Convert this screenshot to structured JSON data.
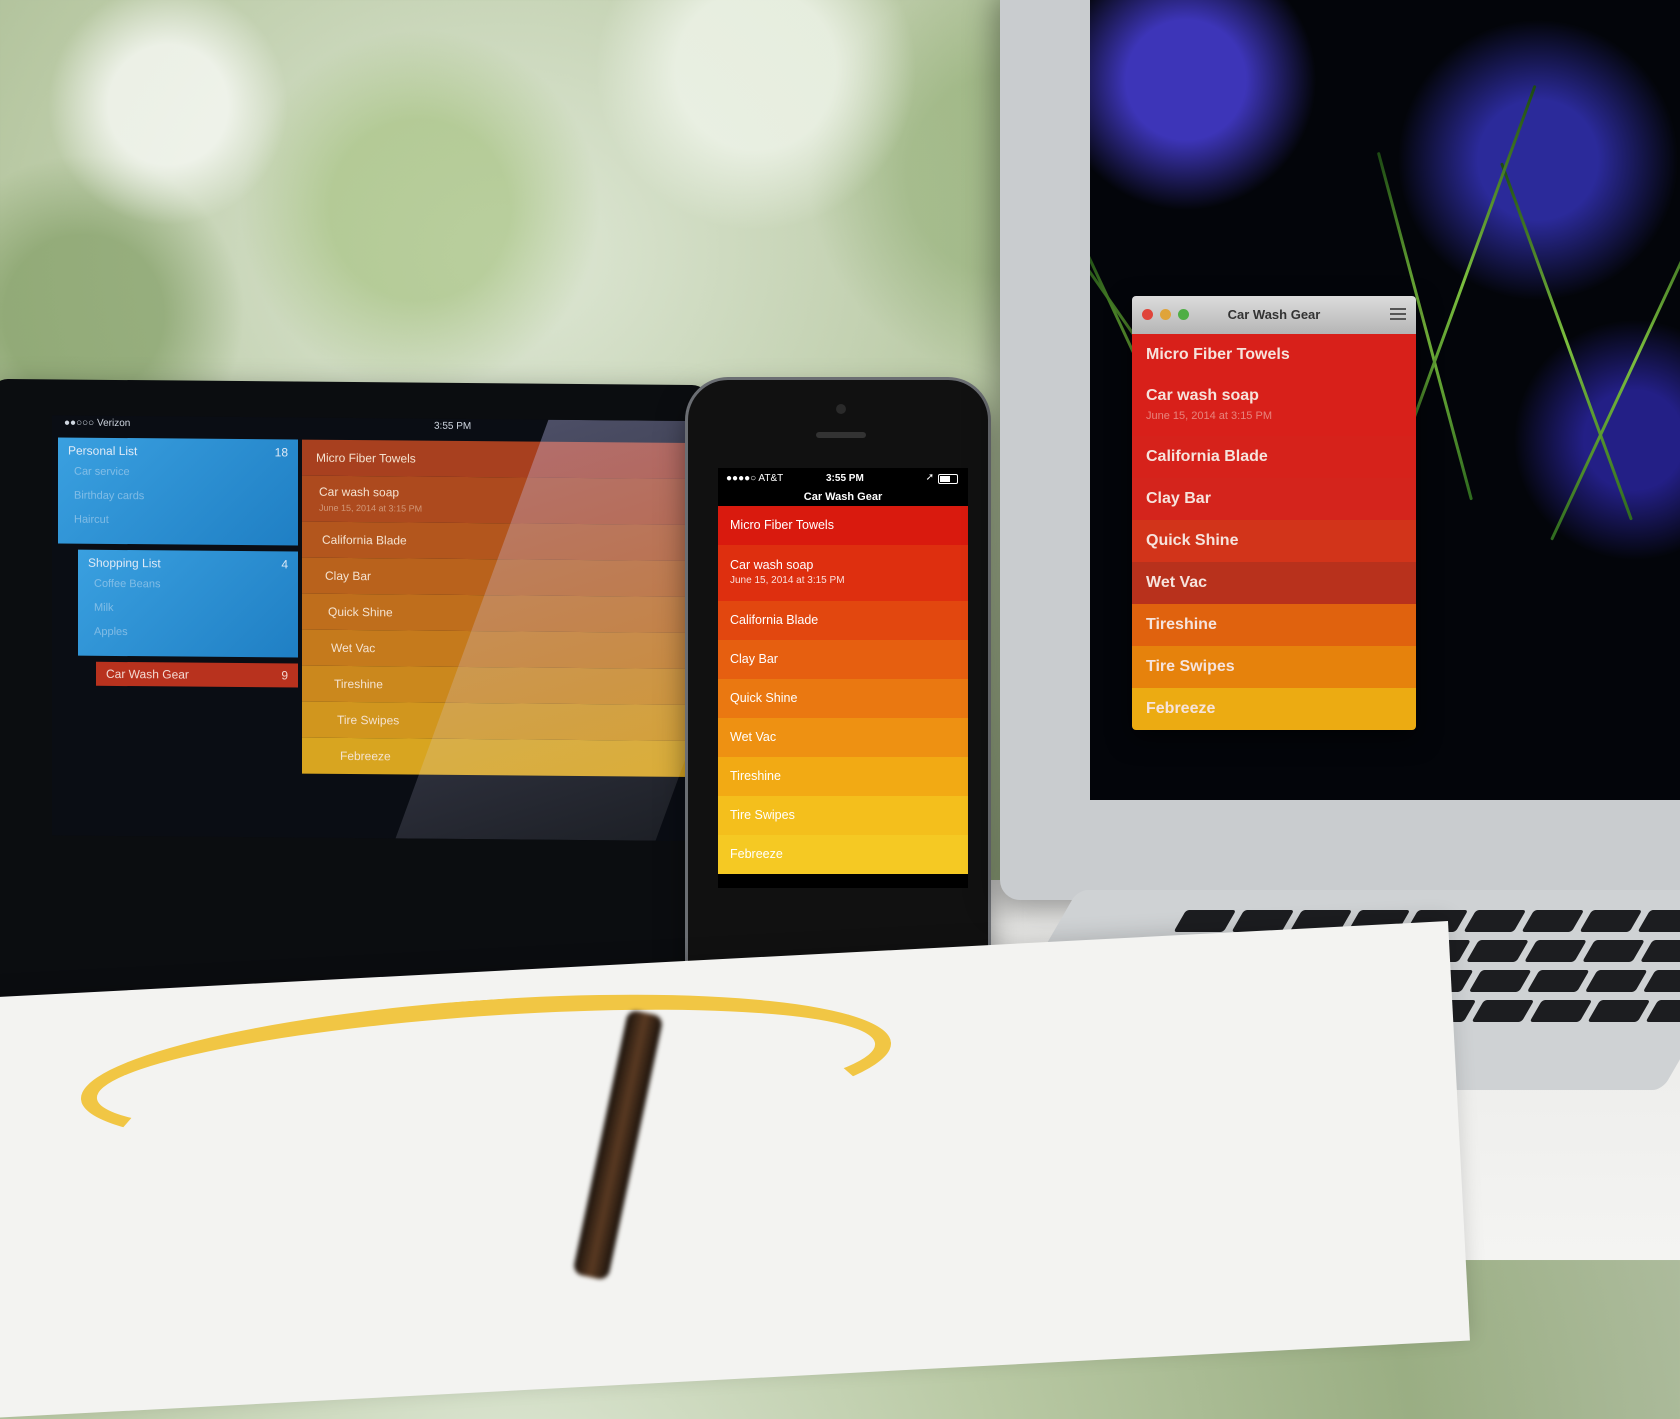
{
  "scene": {
    "description": "Clear to-do app shown on tablet, phone and laptop",
    "list_colors": [
      "#d91a0e",
      "#de2f0f",
      "#e2470f",
      "#e65f10",
      "#ea7811",
      "#ee9112",
      "#f2aa14",
      "#f4bf1c",
      "#f5c923"
    ]
  },
  "tablet": {
    "status": {
      "carrier": "●●○○○ Verizon",
      "time": "3:55 PM"
    },
    "lists": [
      {
        "name": "Personal List",
        "count": "18",
        "items": [
          "Car service",
          "Birthday cards",
          "Haircut"
        ]
      },
      {
        "name": "Shopping List",
        "count": "4",
        "items": [
          "Coffee Beans",
          "Milk",
          "Apples"
        ]
      }
    ],
    "active_list": {
      "name": "Car Wash Gear",
      "count": "9"
    },
    "items": [
      {
        "title": "Micro Fiber Towels"
      },
      {
        "title": "Car wash soap",
        "subtitle": "June 15, 2014 at 3:15 PM"
      },
      {
        "title": "California Blade"
      },
      {
        "title": "Clay Bar"
      },
      {
        "title": "Quick Shine"
      },
      {
        "title": "Wet Vac"
      },
      {
        "title": "Tireshine"
      },
      {
        "title": "Tire Swipes"
      },
      {
        "title": "Febreeze"
      }
    ]
  },
  "phone": {
    "status": {
      "carrier": "●●●●○ AT&T",
      "time": "3:55 PM",
      "location_icon": "location-arrow-icon",
      "battery_icon": "battery-icon"
    },
    "title": "Car Wash Gear",
    "items": [
      {
        "title": "Micro Fiber Towels"
      },
      {
        "title": "Car wash soap",
        "subtitle": "June 15, 2014 at 3:15 PM"
      },
      {
        "title": "California Blade"
      },
      {
        "title": "Clay Bar"
      },
      {
        "title": "Quick Shine"
      },
      {
        "title": "Wet Vac"
      },
      {
        "title": "Tireshine"
      },
      {
        "title": "Tire Swipes"
      },
      {
        "title": "Febreeze"
      }
    ]
  },
  "laptop": {
    "window_title": "Car Wash Gear",
    "traffic_lights": {
      "close": "#e0443a",
      "minimize": "#e0a43a",
      "zoom": "#4fae45"
    },
    "menu_icon": "hamburger-menu-icon",
    "items": [
      {
        "title": "Micro Fiber Towels"
      },
      {
        "title": "Car wash soap",
        "subtitle": "June 15, 2014 at 3:15 PM"
      },
      {
        "title": "California Blade"
      },
      {
        "title": "Clay Bar"
      },
      {
        "title": "Quick Shine"
      },
      {
        "title": "Wet Vac"
      },
      {
        "title": "Tireshine"
      },
      {
        "title": "Tire Swipes"
      },
      {
        "title": "Febreeze"
      }
    ],
    "item_colors": [
      "#d8201a",
      "#d8201a",
      "#d6221b",
      "#d4241c",
      "#d2341a",
      "#b8311c",
      "#e0620e",
      "#e6820c",
      "#ecab12"
    ]
  }
}
